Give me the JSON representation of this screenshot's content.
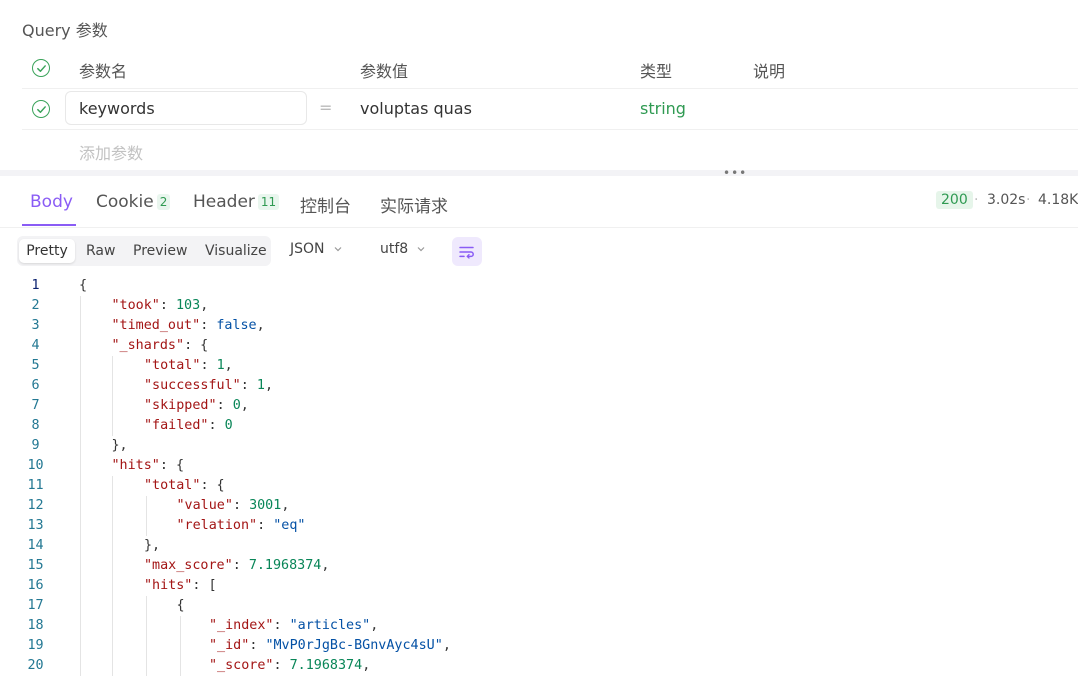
{
  "query": {
    "title": "Query 参数",
    "headers": {
      "name": "参数名",
      "value": "参数值",
      "type": "类型",
      "desc": "说明"
    },
    "params": [
      {
        "name": "keywords",
        "value": "voluptas quas",
        "type": "string"
      }
    ],
    "add_placeholder": "添加参数",
    "equals": "="
  },
  "splitter_dots": "•••",
  "response": {
    "tabs": [
      {
        "label": "Body"
      },
      {
        "label": "Cookie",
        "badge": "2"
      },
      {
        "label": "Header",
        "badge": "11"
      },
      {
        "label": "控制台"
      },
      {
        "label": "实际请求"
      }
    ],
    "status": "200",
    "time": "3.02s",
    "size": "4.18K",
    "separator": "·"
  },
  "viewer": {
    "modes": [
      "Pretty",
      "Raw",
      "Preview",
      "Visualize"
    ],
    "format": "JSON",
    "encoding": "utf8"
  },
  "code_lines": [
    {
      "n": "1",
      "indent": 0,
      "parts": [
        [
          "p",
          "{"
        ]
      ]
    },
    {
      "n": "2",
      "indent": 1,
      "parts": [
        [
          "k",
          "\"took\""
        ],
        [
          "p",
          ": "
        ],
        [
          "n",
          "103"
        ],
        [
          "p",
          ","
        ]
      ]
    },
    {
      "n": "3",
      "indent": 1,
      "parts": [
        [
          "k",
          "\"timed_out\""
        ],
        [
          "p",
          ": "
        ],
        [
          "b",
          "false"
        ],
        [
          "p",
          ","
        ]
      ]
    },
    {
      "n": "4",
      "indent": 1,
      "parts": [
        [
          "k",
          "\"_shards\""
        ],
        [
          "p",
          ": {"
        ]
      ]
    },
    {
      "n": "5",
      "indent": 2,
      "parts": [
        [
          "k",
          "\"total\""
        ],
        [
          "p",
          ": "
        ],
        [
          "n",
          "1"
        ],
        [
          "p",
          ","
        ]
      ]
    },
    {
      "n": "6",
      "indent": 2,
      "parts": [
        [
          "k",
          "\"successful\""
        ],
        [
          "p",
          ": "
        ],
        [
          "n",
          "1"
        ],
        [
          "p",
          ","
        ]
      ]
    },
    {
      "n": "7",
      "indent": 2,
      "parts": [
        [
          "k",
          "\"skipped\""
        ],
        [
          "p",
          ": "
        ],
        [
          "n",
          "0"
        ],
        [
          "p",
          ","
        ]
      ]
    },
    {
      "n": "8",
      "indent": 2,
      "parts": [
        [
          "k",
          "\"failed\""
        ],
        [
          "p",
          ": "
        ],
        [
          "n",
          "0"
        ]
      ]
    },
    {
      "n": "9",
      "indent": 1,
      "parts": [
        [
          "p",
          "},"
        ]
      ]
    },
    {
      "n": "10",
      "indent": 1,
      "parts": [
        [
          "k",
          "\"hits\""
        ],
        [
          "p",
          ": {"
        ]
      ]
    },
    {
      "n": "11",
      "indent": 2,
      "parts": [
        [
          "k",
          "\"total\""
        ],
        [
          "p",
          ": {"
        ]
      ]
    },
    {
      "n": "12",
      "indent": 3,
      "parts": [
        [
          "k",
          "\"value\""
        ],
        [
          "p",
          ": "
        ],
        [
          "n",
          "3001"
        ],
        [
          "p",
          ","
        ]
      ]
    },
    {
      "n": "13",
      "indent": 3,
      "parts": [
        [
          "k",
          "\"relation\""
        ],
        [
          "p",
          ": "
        ],
        [
          "s",
          "\"eq\""
        ]
      ]
    },
    {
      "n": "14",
      "indent": 2,
      "parts": [
        [
          "p",
          "},"
        ]
      ]
    },
    {
      "n": "15",
      "indent": 2,
      "parts": [
        [
          "k",
          "\"max_score\""
        ],
        [
          "p",
          ": "
        ],
        [
          "n",
          "7.1968374"
        ],
        [
          "p",
          ","
        ]
      ]
    },
    {
      "n": "16",
      "indent": 2,
      "parts": [
        [
          "k",
          "\"hits\""
        ],
        [
          "p",
          ": ["
        ]
      ]
    },
    {
      "n": "17",
      "indent": 3,
      "parts": [
        [
          "p",
          "{"
        ]
      ]
    },
    {
      "n": "18",
      "indent": 4,
      "parts": [
        [
          "k",
          "\"_index\""
        ],
        [
          "p",
          ": "
        ],
        [
          "s",
          "\"articles\""
        ],
        [
          "p",
          ","
        ]
      ]
    },
    {
      "n": "19",
      "indent": 4,
      "parts": [
        [
          "k",
          "\"_id\""
        ],
        [
          "p",
          ": "
        ],
        [
          "s",
          "\"MvP0rJgBc-BGnvAyc4sU\""
        ],
        [
          "p",
          ","
        ]
      ]
    },
    {
      "n": "20",
      "indent": 4,
      "parts": [
        [
          "k",
          "\"_score\""
        ],
        [
          "p",
          ": "
        ],
        [
          "n",
          "7.1968374"
        ],
        [
          "p",
          ","
        ]
      ]
    }
  ]
}
